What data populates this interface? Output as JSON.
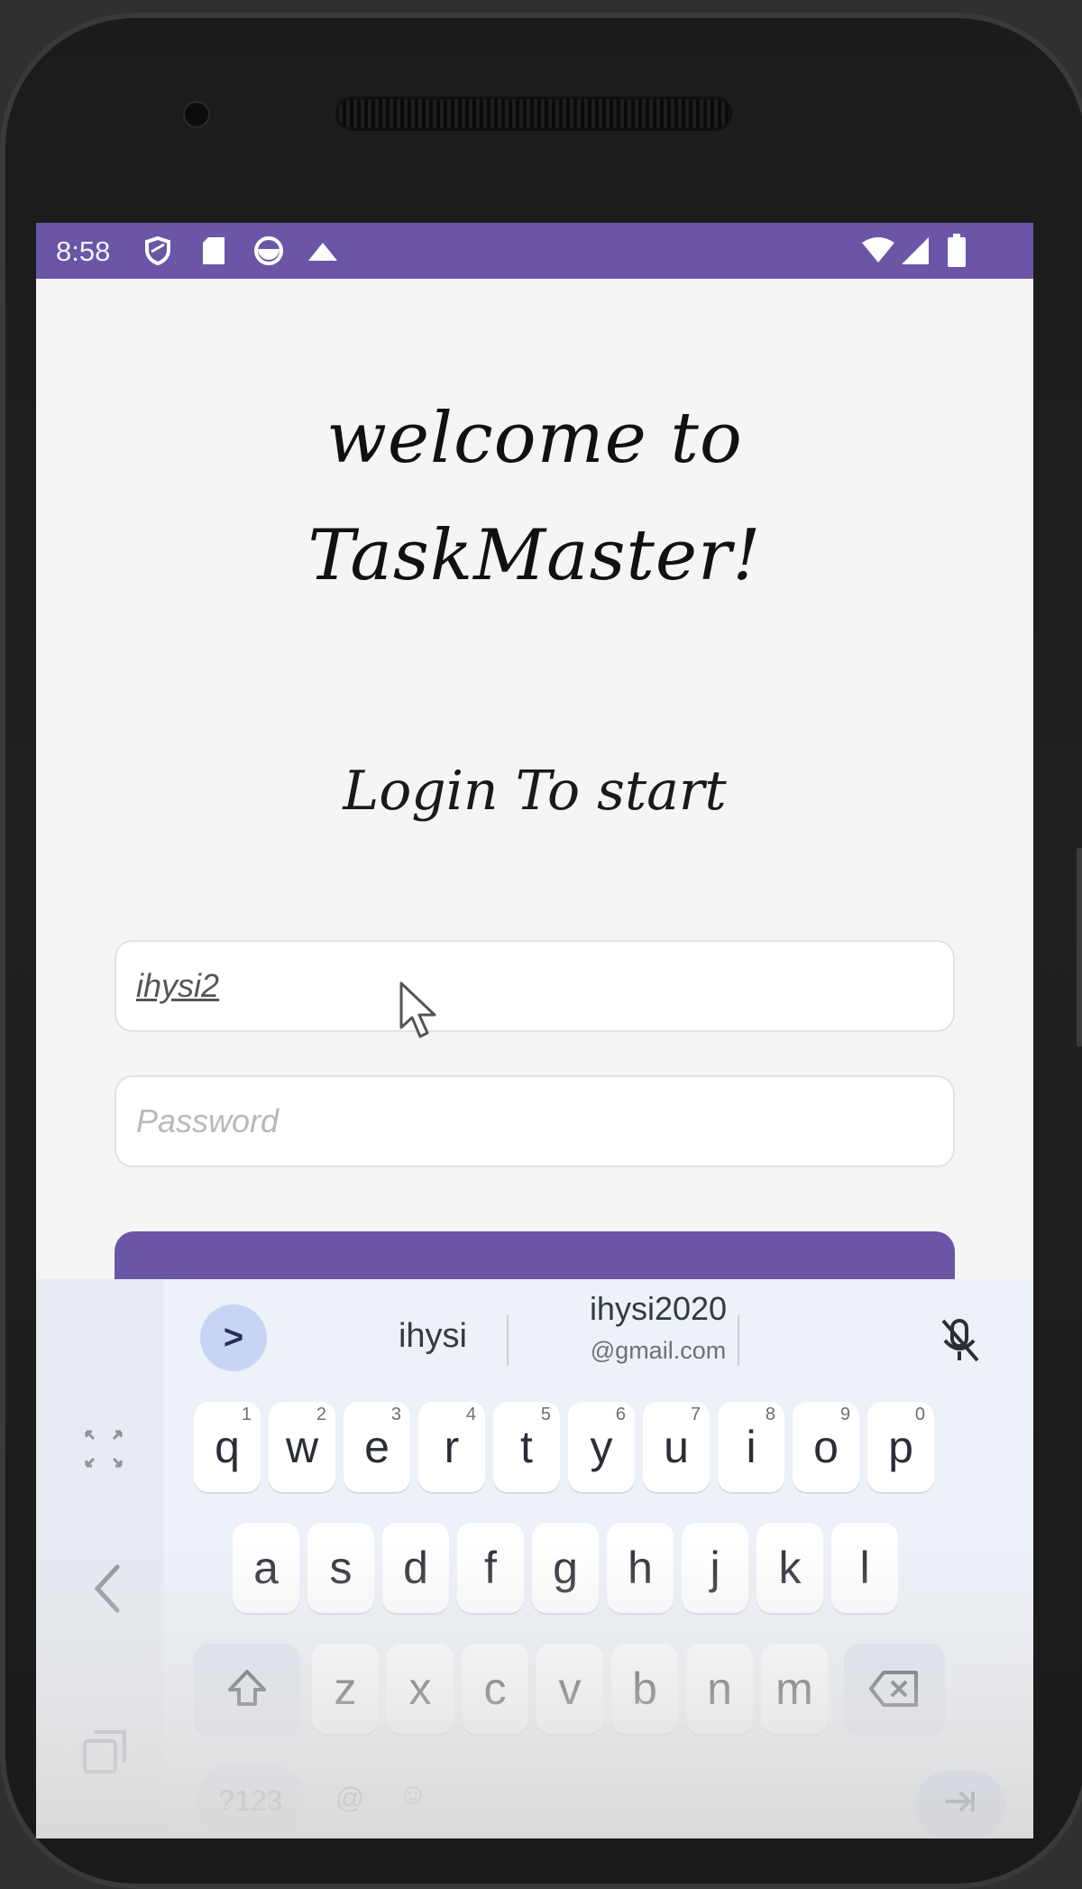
{
  "status_bar": {
    "time": "8:58",
    "color": "#6a55a6",
    "left_icons": [
      "shield-icon",
      "sd-card-icon",
      "vpn-icon",
      "cloud-icon"
    ],
    "right_icons": [
      "wifi-icon",
      "signal-icon",
      "battery-icon"
    ]
  },
  "app": {
    "welcome_line1": "welcome to",
    "welcome_line2": "TaskMaster!",
    "login_title": "Login To start",
    "username_value": "ihysi2",
    "password_placeholder": "Password",
    "accent_color": "#6a55a6"
  },
  "keyboard": {
    "suggestions": {
      "chevron": ">",
      "word1": "ihysi",
      "word2_top": "ihysi2020",
      "word2_bottom": "@gmail.com",
      "mic_off_icon": "mic-off-icon"
    },
    "row1": [
      {
        "key": "q",
        "num": "1"
      },
      {
        "key": "w",
        "num": "2"
      },
      {
        "key": "e",
        "num": "3"
      },
      {
        "key": "r",
        "num": "4"
      },
      {
        "key": "t",
        "num": "5"
      },
      {
        "key": "y",
        "num": "6"
      },
      {
        "key": "u",
        "num": "7"
      },
      {
        "key": "i",
        "num": "8"
      },
      {
        "key": "o",
        "num": "9"
      },
      {
        "key": "p",
        "num": "0"
      }
    ],
    "row2": [
      "a",
      "s",
      "d",
      "f",
      "g",
      "h",
      "j",
      "k",
      "l"
    ],
    "row3": [
      "z",
      "x",
      "c",
      "v",
      "b",
      "n",
      "m"
    ],
    "bottom": {
      "symbols": "?123",
      "at": "@",
      "emoji": "☺"
    }
  }
}
